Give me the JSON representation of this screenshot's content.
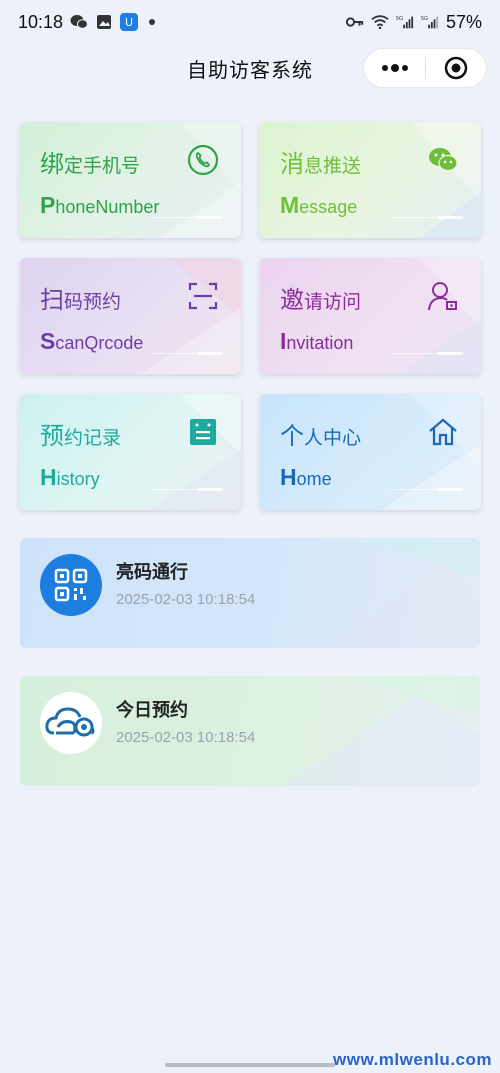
{
  "status_bar": {
    "time": "10:18",
    "battery": "57%",
    "left_icons": [
      "wechat-icon",
      "gallery-icon",
      "app-badge-icon"
    ],
    "right_icons": [
      "key-icon",
      "wifi-icon",
      "signal-5g-icon",
      "signal-5g-icon"
    ],
    "badge_text": "U"
  },
  "nav": {
    "title": "自助访客系统"
  },
  "tiles": [
    {
      "cn_first": "绑",
      "cn_rest": "定手机号",
      "en_first": "P",
      "en_rest": "honeNumber",
      "icon": "phone-icon",
      "color": "#2fa34a"
    },
    {
      "cn_first": "消",
      "cn_rest": "息推送",
      "en_first": "M",
      "en_rest": "essage",
      "icon": "wechat-icon",
      "color": "#6fbf3a"
    },
    {
      "cn_first": "扫",
      "cn_rest": "码预约",
      "en_first": "S",
      "en_rest": "canQrcode",
      "icon": "scan-icon",
      "color": "#6b3fa5"
    },
    {
      "cn_first": "邀",
      "cn_rest": "请访问",
      "en_first": "I",
      "en_rest": "nvitation",
      "icon": "user-badge-icon",
      "color": "#8a2d9b"
    },
    {
      "cn_first": "预",
      "cn_rest": "约记录",
      "en_first": "H",
      "en_rest": "istory",
      "icon": "list-icon",
      "color": "#1eab9d"
    },
    {
      "cn_first": "个",
      "cn_rest": "人中心",
      "en_first": "H",
      "en_rest": "ome",
      "icon": "home-icon",
      "color": "#1a69b8"
    }
  ],
  "cards": [
    {
      "title": "亮码通行",
      "time": "2025-02-03 10:18:54",
      "icon": "qrcode-icon"
    },
    {
      "title": "今日预约",
      "time": "2025-02-03 10:18:54",
      "icon": "cloud-logo-icon"
    }
  ],
  "watermark": "www.mlwenlu.com"
}
